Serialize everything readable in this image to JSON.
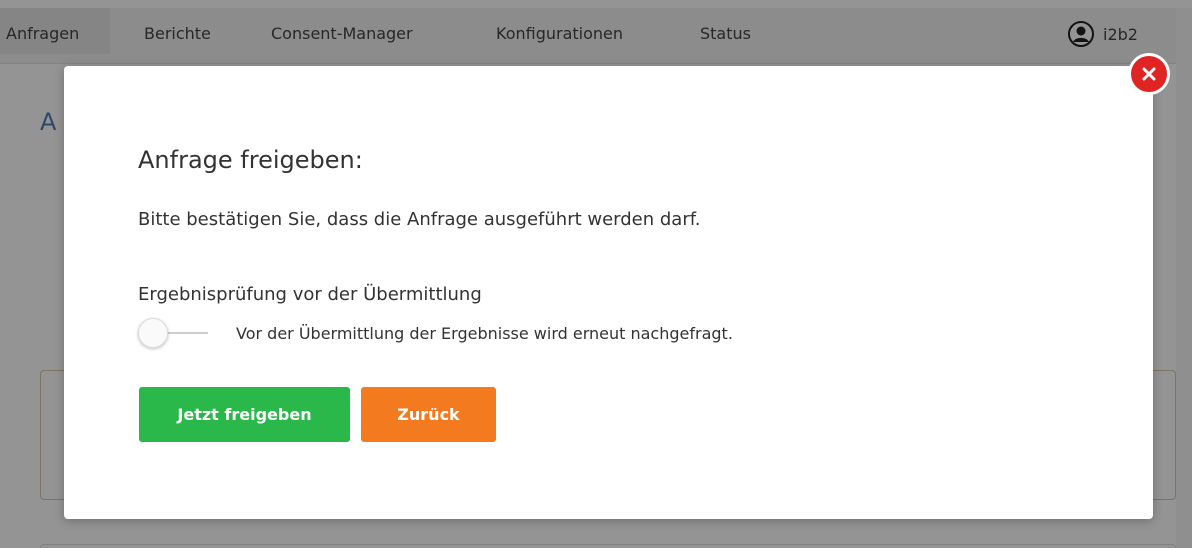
{
  "nav": {
    "items": [
      {
        "label": "Anfragen"
      },
      {
        "label": "Berichte"
      },
      {
        "label": "Consent-Manager"
      },
      {
        "label": "Konfigurationen"
      },
      {
        "label": "Status"
      }
    ],
    "user": {
      "name": "i2b2",
      "icon": "user-circle-icon"
    }
  },
  "background": {
    "heading_fragment": "A"
  },
  "modal": {
    "title": "Anfrage freigeben:",
    "text": "Bitte bestätigen Sie, dass die Anfrage ausgeführt werden darf.",
    "toggle_label": "Ergebnisprüfung vor der Übermittlung",
    "toggle_hint": "Vor der Übermittlung der Ergebnisse wird erneut nachgefragt.",
    "toggle_on": false,
    "confirm_label": "Jetzt freigeben",
    "back_label": "Zurück",
    "close_icon": "close-icon"
  },
  "colors": {
    "confirm": "#2bb84a",
    "back": "#f47a20",
    "close": "#e02424",
    "heading_blue": "#4a7ebb"
  }
}
